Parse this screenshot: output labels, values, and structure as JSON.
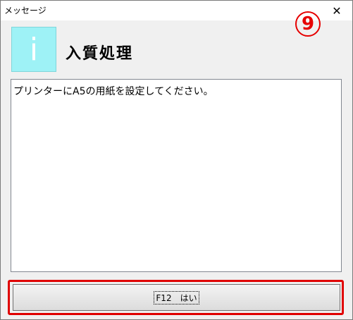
{
  "window": {
    "title": "メッセージ",
    "close_glyph": "✕"
  },
  "marker": {
    "label": "9"
  },
  "header": {
    "icon_glyph": "i",
    "icon_name": "info-icon",
    "heading": "入質処理"
  },
  "message": {
    "text": "プリンターにA5の用紙を設定してください。"
  },
  "actions": {
    "ok_label": "F12　はい"
  },
  "colors": {
    "icon_bg": "#9ef2f6",
    "marker": "#e60000"
  }
}
